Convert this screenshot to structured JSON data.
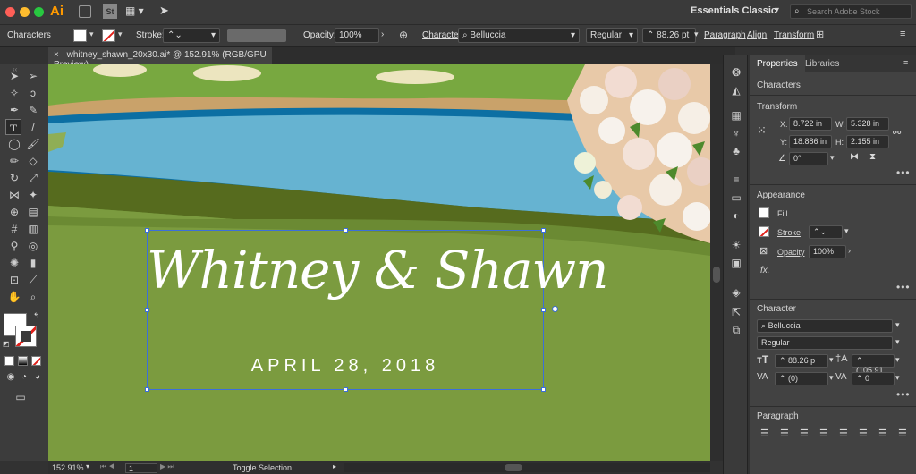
{
  "app": {
    "logo": "Ai",
    "workspace": "Essentials Classic",
    "search_placeholder": "Search Adobe Stock",
    "bridge_label": "St"
  },
  "control_bar": {
    "mode": "Characters",
    "stroke_label": "Stroke:",
    "opacity_label": "Opacity:",
    "opacity_value": "100%",
    "character_label": "Character:",
    "font": "Belluccia",
    "style": "Regular",
    "size": "88.26 pt",
    "paragraph": "Paragraph",
    "align": "Align",
    "transform": "Transform"
  },
  "document": {
    "tab_title": "whitney_shawn_20x30.ai* @ 152.91% (RGB/GPU Preview)",
    "close": "×"
  },
  "artwork": {
    "names": "Whitney & Shawn",
    "date": "APRIL 28, 2018"
  },
  "status": {
    "zoom": "152.91%",
    "page": "1",
    "toggle": "Toggle Selection"
  },
  "panel": {
    "tabs": [
      "Properties",
      "Libraries"
    ],
    "section_characters": "Characters",
    "transform": {
      "title": "Transform",
      "x_label": "X:",
      "x": "8.722 in",
      "y_label": "Y:",
      "y": "18.886 in",
      "w_label": "W:",
      "w": "5.328 in",
      "h_label": "H:",
      "h": "2.155 in",
      "angle": "0°"
    },
    "appearance": {
      "title": "Appearance",
      "fill": "Fill",
      "stroke": "Stroke",
      "opacity": "Opacity",
      "opacity_value": "100%",
      "fx": "fx."
    },
    "character": {
      "title": "Character",
      "font": "Belluccia",
      "style": "Regular",
      "size": "88.26 p",
      "leading": "(105.91",
      "kerning": "(0)",
      "tracking": "0"
    },
    "paragraph": {
      "title": "Paragraph"
    }
  },
  "colors": {
    "accent": "#3b6fd9",
    "grass": "#6b9b3a",
    "water": "#66b3d1"
  }
}
